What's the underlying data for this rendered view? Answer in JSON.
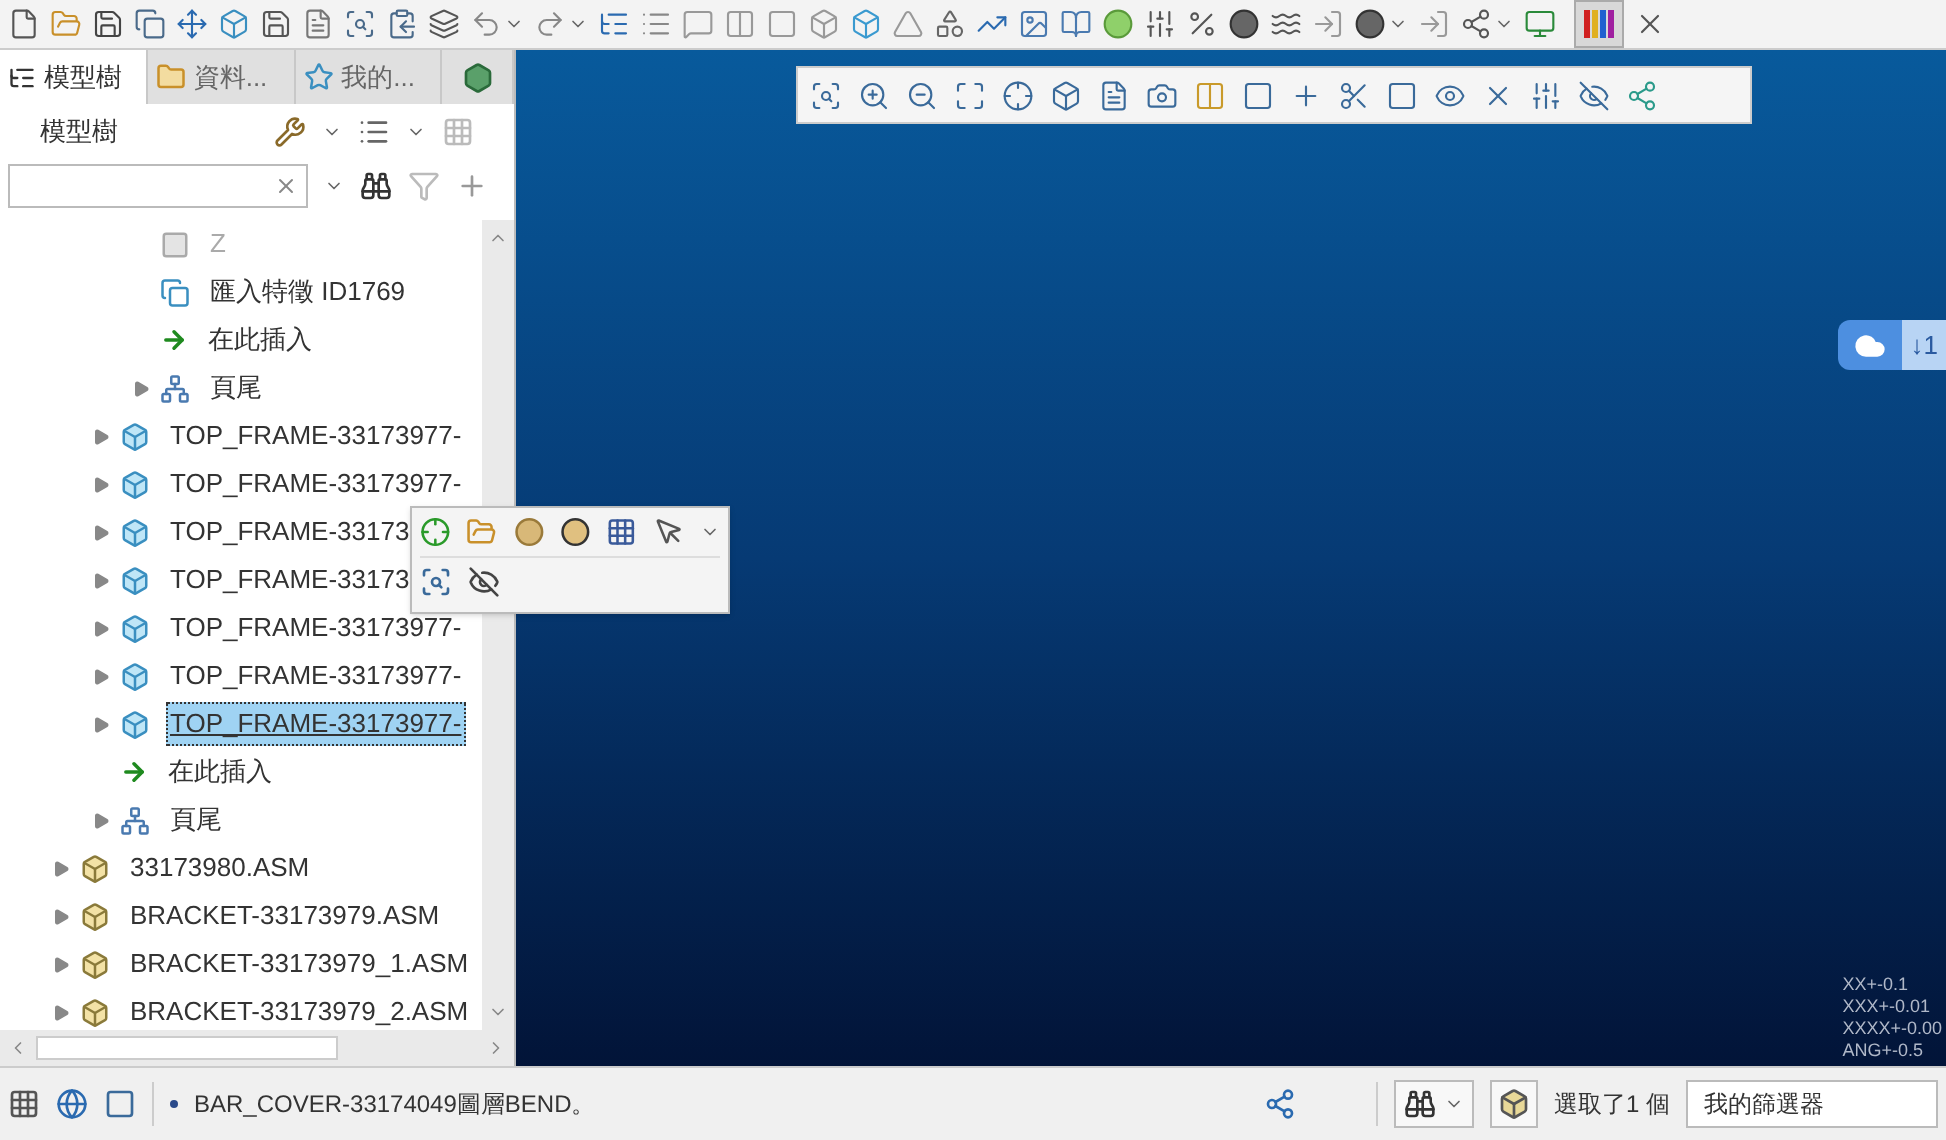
{
  "toolbar": {
    "color_button_on": true
  },
  "panel": {
    "tabs": [
      {
        "label": "模型樹",
        "selected": true,
        "kind": "tree"
      },
      {
        "label": "資料...",
        "selected": false,
        "kind": "folders"
      },
      {
        "label": "我的...",
        "selected": false,
        "kind": "favorites"
      },
      {
        "selected": false,
        "kind": "layers"
      }
    ],
    "title": "模型樹"
  },
  "tree": {
    "items": [
      {
        "children": [
          {
            "children": [
              {
                "label": "Z",
                "kind": "datum",
                "disabled": true,
                "selected": false
              },
              {
                "label": "匯入特徵 ID1769",
                "kind": "import",
                "disabled": false,
                "selected": false
              },
              {
                "label": "在此插入",
                "kind": "insert",
                "disabled": false,
                "selected": false
              },
              {
                "label": "頁尾",
                "kind": "footer",
                "expanded": false,
                "disabled": false,
                "selected": false
              }
            ]
          },
          {
            "label": "TOP_FRAME-33173977-",
            "kind": "part",
            "expanded": false,
            "disabled": false,
            "selected": false
          },
          {
            "label": "TOP_FRAME-33173977-",
            "kind": "part",
            "expanded": false,
            "disabled": false,
            "selected": false
          },
          {
            "label": "TOP_FRAME-33173",
            "kind": "part",
            "expanded": false,
            "disabled": false,
            "selected": false
          },
          {
            "label": "TOP_FRAME-33173",
            "kind": "part",
            "expanded": false,
            "disabled": false,
            "selected": false
          },
          {
            "label": "TOP_FRAME-33173977-",
            "kind": "part",
            "expanded": false,
            "disabled": false,
            "selected": false
          },
          {
            "label": "TOP_FRAME-33173977-",
            "kind": "part",
            "expanded": false,
            "disabled": false,
            "selected": false
          },
          {
            "label": "TOP_FRAME-33173977-",
            "kind": "part",
            "expanded": false,
            "disabled": false,
            "selected": true
          },
          {
            "label": "在此插入",
            "kind": "insert",
            "disabled": false,
            "selected": false
          },
          {
            "label": "頁尾",
            "kind": "footer",
            "expanded": false,
            "disabled": false,
            "selected": false
          }
        ]
      },
      {
        "label": "33173980.ASM",
        "kind": "asm",
        "expanded": false,
        "disabled": false,
        "selected": false
      },
      {
        "label": "BRACKET-33173979.ASM",
        "kind": "asm",
        "expanded": false,
        "disabled": false,
        "selected": false
      },
      {
        "label": "BRACKET-33173979_1.ASM",
        "kind": "asm",
        "expanded": false,
        "disabled": false,
        "selected": false
      },
      {
        "label": "BRACKET-33173979_2.ASM",
        "kind": "asm",
        "expanded": false,
        "disabled": false,
        "selected": false
      }
    ]
  },
  "viewport": {
    "badge": "↓1",
    "tolerances": [
      "XX+-0.1",
      "XXX+-0.01",
      "XXXX+-0.00",
      "ANG+-0.5"
    ]
  },
  "status_bar": {
    "message": "BAR_COVER-33174049圖層BEND。",
    "selection": "選取了1 個",
    "filter": "我的篩選器"
  }
}
